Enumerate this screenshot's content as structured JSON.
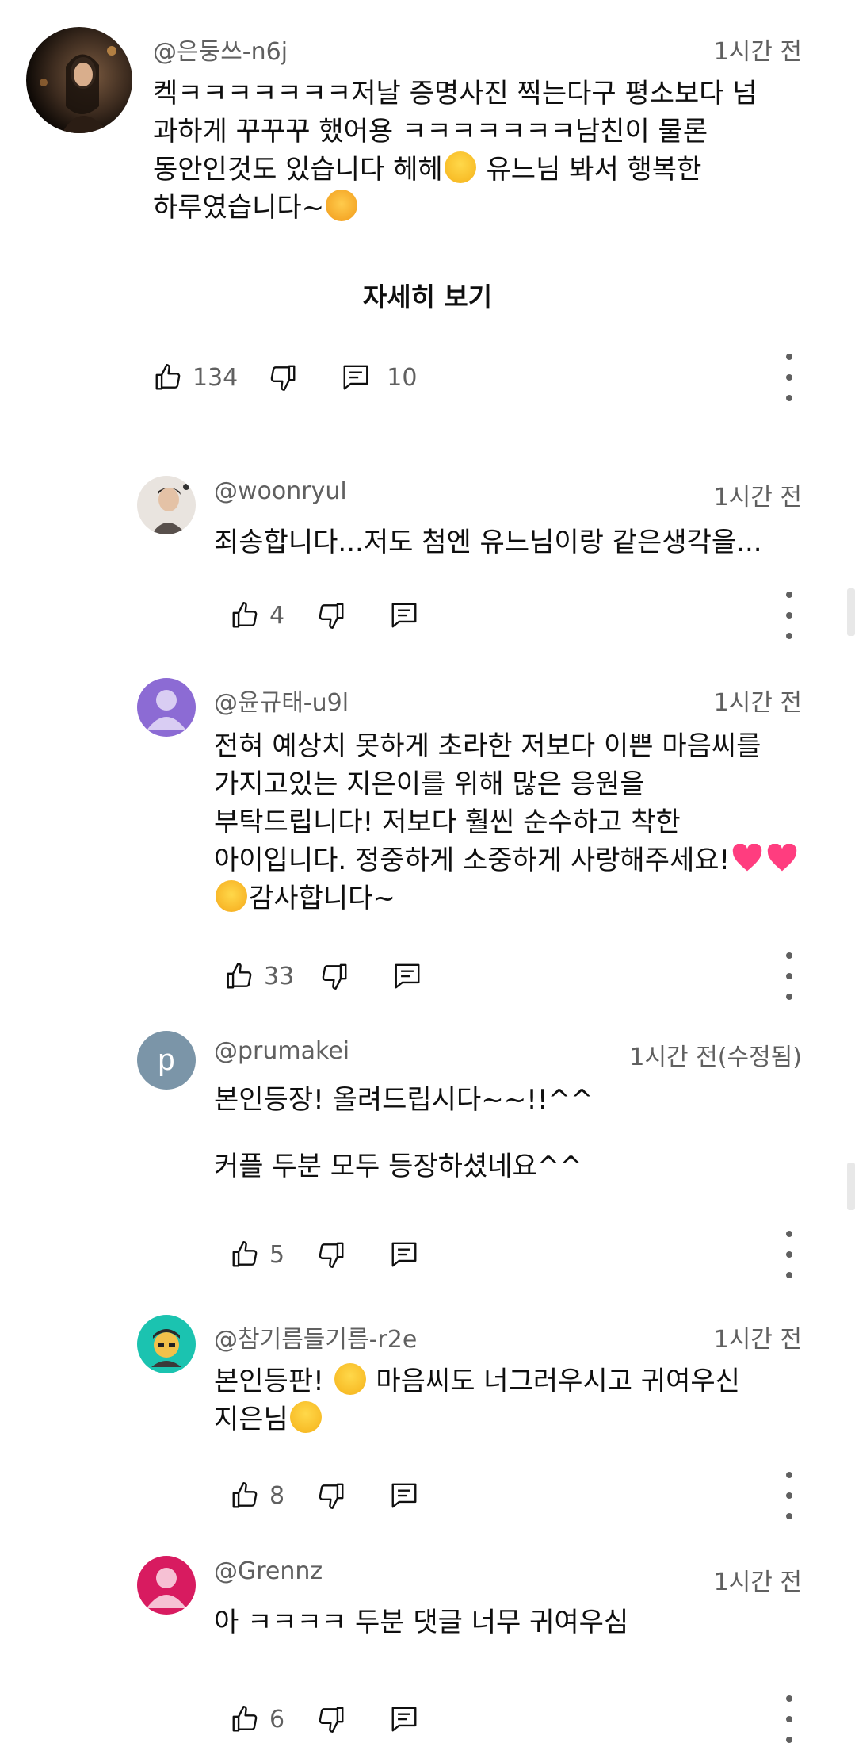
{
  "comments": [
    {
      "handle": "@은둥쓰-n6j",
      "time": "1시간 전",
      "text": "켁ㅋㅋㅋㅋㅋㅋㅋ저날 증명사진 찍는다구 평소보다 넘 과하게 꾸꾸꾸 했어용 ㅋㅋㅋㅋㅋㅋㅋ남친이 물론 동안인것도 있습니다 헤헤😂 유느님 봐서 행복한 하루였습니다~😻",
      "read_more": "자세히 보기",
      "likes": "134",
      "replies": "10"
    }
  ],
  "replies": [
    {
      "handle": "@woonryul",
      "time": "1시간 전",
      "text": "죄송합니다...저도 첨엔 유느님이랑 같은생각을...",
      "likes": "4"
    },
    {
      "handle": "@윤규태-u9l",
      "time": "1시간 전",
      "text": "전혀 예상치 못하게 초라한 저보다 이쁜 마음씨를 가지고있는 지은이를 위해 많은 응원을 부탁드립니다! 저보다 훨씬 순수하고 착한 아이입니다. 정중하게 소중하게 사랑해주세요!💗💗🥰감사합니다~",
      "likes": "33"
    },
    {
      "handle": "@prumakei",
      "avatar_letter": "p",
      "time": "1시간 전(수정됨)",
      "text": "본인등장! 올려드립시다~~!!^^\n\n커플 두분 모두 등장하셨네요^^",
      "likes": "5"
    },
    {
      "handle": "@참기름들기름-r2e",
      "time": "1시간 전",
      "text": "본인등판! 😮 마음씨도 너그러우시고 귀여우신 지은님😂",
      "likes": "8"
    },
    {
      "handle": "@Grennz",
      "time": "1시간 전",
      "text": "아 ㅋㅋㅋㅋ 두분 댓글 너무 귀여우심",
      "likes": "6"
    }
  ],
  "colors": {
    "text_primary": "#0f0f0f",
    "text_secondary": "#606060",
    "avatar_purple": "#8c6bd4",
    "avatar_slate": "#7b95a8",
    "avatar_teal": "#1bc3b0",
    "avatar_pink": "#d81b60"
  },
  "icons": [
    "thumb-up-icon",
    "thumb-down-icon",
    "reply-icon",
    "more-vert-icon"
  ]
}
